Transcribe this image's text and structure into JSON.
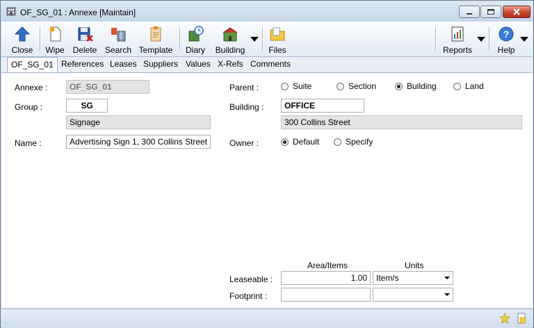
{
  "window": {
    "title": "OF_SG_01 : Annexe [Maintain]"
  },
  "toolbar": {
    "close": "Close",
    "wipe": "Wipe",
    "delete": "Delete",
    "search": "Search",
    "template": "Template",
    "diary": "Diary",
    "building": "Building",
    "files": "Files",
    "reports": "Reports",
    "help": "Help"
  },
  "tabs": [
    "OF_SG_01",
    "References",
    "Leases",
    "Suppliers",
    "Values",
    "X-Refs",
    "Comments"
  ],
  "form": {
    "annexe_label": "Annexe :",
    "annexe_value": "OF_SG_01",
    "group_label": "Group :",
    "group_code": "SG",
    "group_name": "Signage",
    "name_label": "Name :",
    "name_value": "Advertising Sign 1, 300 Collins Street",
    "parent_label": "Parent :",
    "parent_options": [
      "Suite",
      "Section",
      "Building",
      "Land"
    ],
    "parent_selected": "Building",
    "building_label": "Building :",
    "building_code": "OFFICE",
    "building_name": "300 Collins Street",
    "owner_label": "Owner :",
    "owner_options": [
      "Default",
      "Specify"
    ],
    "owner_selected": "Default",
    "area_header": "Area/Items",
    "units_header": "Units",
    "leaseable_label": "Leaseable :",
    "leaseable_value": "1.00",
    "leaseable_units": "Item/s",
    "footprint_label": "Footprint :",
    "footprint_value": "",
    "footprint_units": ""
  },
  "icons": {
    "app": "building-icon",
    "close": "up-arrow-icon",
    "wipe": "new-page-icon",
    "delete": "floppy-delete-icon",
    "search": "search-grid-icon",
    "template": "clipboard-icon",
    "diary": "diary-clock-icon",
    "building": "building-icon",
    "files": "folder-icon",
    "reports": "report-icon",
    "help": "help-icon",
    "status_favorite": "star-icon",
    "status_docs": "document-icon"
  },
  "colors": {
    "titlebar": "#c6d6ea",
    "close_button": "#c9442c",
    "readonly_field": "#e4e4e4",
    "accent_blue": "#2f6fc2"
  }
}
